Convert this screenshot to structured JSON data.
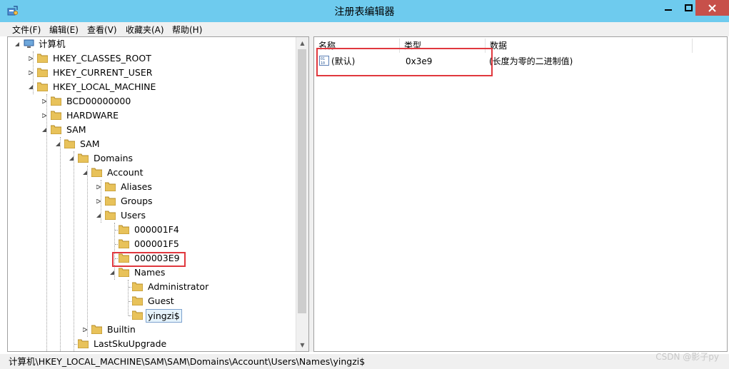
{
  "window": {
    "title": "注册表编辑器"
  },
  "menu": [
    "文件(F)",
    "编辑(E)",
    "查看(V)",
    "收藏夹(A)",
    "帮助(H)"
  ],
  "tree": {
    "root": "计算机",
    "nodes": {
      "hkcr": "HKEY_CLASSES_ROOT",
      "hkcu": "HKEY_CURRENT_USER",
      "hklm": "HKEY_LOCAL_MACHINE",
      "bcd": "BCD00000000",
      "hardware": "HARDWARE",
      "sam": "SAM",
      "sam2": "SAM",
      "domains": "Domains",
      "account": "Account",
      "aliases": "Aliases",
      "groups": "Groups",
      "users": "Users",
      "u1f4": "000001F4",
      "u1f5": "000001F5",
      "u3e9": "000003E9",
      "names": "Names",
      "administrator": "Administrator",
      "guest": "Guest",
      "yingzi": "yingzi$",
      "builtin": "Builtin",
      "lastsku": "LastSkuUpgrade"
    },
    "selected": "yingzi$"
  },
  "list": {
    "columns": [
      "名称",
      "类型",
      "数据"
    ],
    "rows": [
      {
        "name": "(默认)",
        "type": "0x3e9",
        "data": "(长度为零的二进制值)"
      }
    ]
  },
  "status": {
    "path": "计算机\\HKEY_LOCAL_MACHINE\\SAM\\SAM\\Domains\\Account\\Users\\Names\\yingzi$"
  },
  "watermark": "CSDN @影子py",
  "colors": {
    "titlebar": "#6ecbee",
    "close": "#c7504a",
    "highlight": "#e0383e",
    "folder": "#e8c25a"
  }
}
